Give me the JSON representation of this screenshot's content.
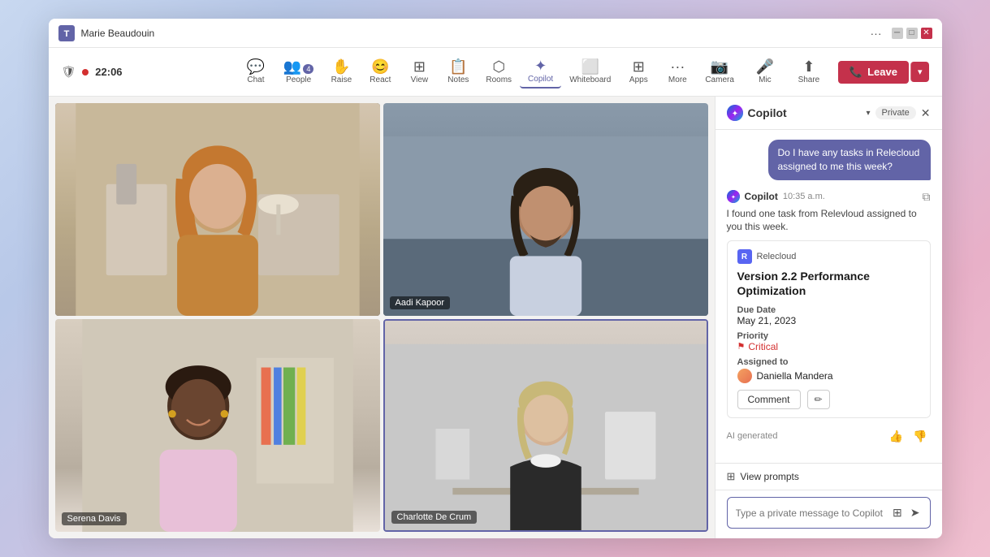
{
  "window": {
    "title": "Marie Beaudouin",
    "timer": "22:06"
  },
  "toolbar": {
    "tools": [
      {
        "id": "chat",
        "label": "Chat",
        "icon": "💬",
        "badge": null
      },
      {
        "id": "people",
        "label": "People",
        "icon": "👥",
        "badge": "4"
      },
      {
        "id": "raise",
        "label": "Raise",
        "icon": "✋",
        "badge": null
      },
      {
        "id": "react",
        "label": "React",
        "icon": "😊",
        "badge": null
      },
      {
        "id": "view",
        "label": "View",
        "icon": "⊞",
        "badge": null
      },
      {
        "id": "notes",
        "label": "Notes",
        "icon": "📋",
        "badge": null
      },
      {
        "id": "rooms",
        "label": "Rooms",
        "icon": "⬚",
        "badge": null
      },
      {
        "id": "copilot",
        "label": "Copilot",
        "icon": "✦",
        "badge": null,
        "active": true
      },
      {
        "id": "whiteboard",
        "label": "Whiteboard",
        "icon": "⬜",
        "badge": null
      },
      {
        "id": "apps",
        "label": "Apps",
        "icon": "⊞",
        "badge": null
      },
      {
        "id": "more",
        "label": "More",
        "icon": "•••",
        "badge": null
      }
    ],
    "right_tools": [
      {
        "id": "camera",
        "label": "Camera",
        "icon": "📷"
      },
      {
        "id": "mic",
        "label": "Mic",
        "icon": "🎤"
      },
      {
        "id": "share",
        "label": "Share",
        "icon": "⬆"
      }
    ],
    "leave_label": "Leave"
  },
  "participants": [
    {
      "id": "p1",
      "name": null,
      "active": false
    },
    {
      "id": "p2",
      "name": "Aadi Kapoor",
      "active": false
    },
    {
      "id": "p3",
      "name": "Serena Davis",
      "active": false
    },
    {
      "id": "p4",
      "name": "Charlotte De Crum",
      "active": true
    }
  ],
  "copilot": {
    "title": "Copilot",
    "private_badge": "Private",
    "user_message": "Do I have any tasks in Relecloud assigned to me this week?",
    "response_name": "Copilot",
    "response_time": "10:35 a.m.",
    "response_text": "I found one task from Relevloud assigned to you this week.",
    "task_card": {
      "source": "Relecloud",
      "title": "Version 2.2 Performance Optimization",
      "due_date_label": "Due Date",
      "due_date": "May 21, 2023",
      "priority_label": "Priority",
      "priority": "Critical",
      "assigned_label": "Assigned to",
      "assigned_name": "Daniella Mandera",
      "comment_label": "Comment",
      "edit_label": "✏"
    },
    "ai_generated_label": "AI generated",
    "view_prompts_label": "View prompts",
    "input_placeholder": "Type a private message to Copilot"
  }
}
